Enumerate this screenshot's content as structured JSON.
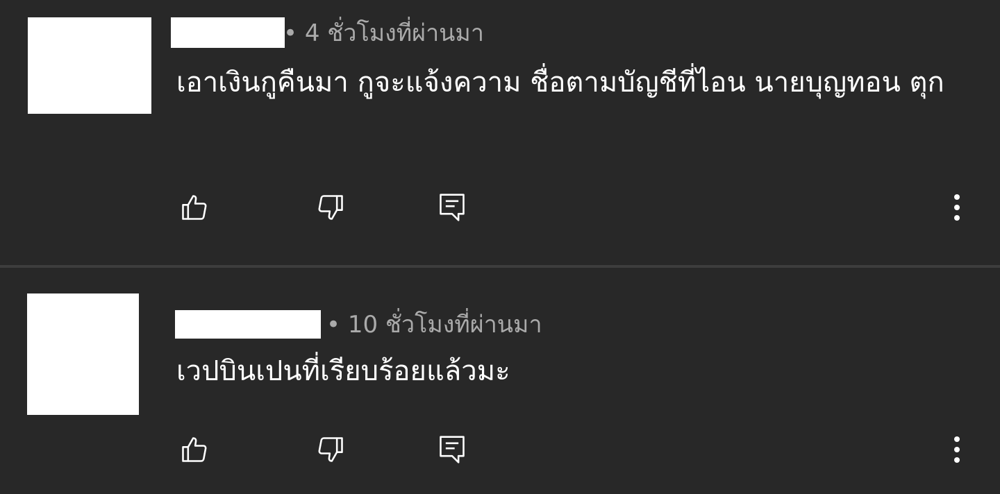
{
  "comments": [
    {
      "time": "• 4 ชั่วโมงที่ผ่านมา",
      "text": "เอาเงินกูคืนมา กูจะแจ้งความ ชื่อตามบัญชีที่ไอน นายบุญทอน ตุก",
      "actions": {
        "like": "thumb-up-icon",
        "dislike": "thumb-down-icon",
        "reply": "reply-icon",
        "more": "more-vert-icon"
      }
    },
    {
      "time": "• 10 ชั่วโมงที่ผ่านมา",
      "text": "เวปบินเปนที่เรียบร้อยแล้วมะ",
      "actions": {
        "like": "thumb-up-icon",
        "dislike": "thumb-down-icon",
        "reply": "reply-icon",
        "more": "more-vert-icon"
      }
    }
  ],
  "colors": {
    "background": "#282828",
    "text_primary": "#ffffff",
    "text_secondary": "#aaaaaa",
    "divider": "#3d3d3d"
  }
}
